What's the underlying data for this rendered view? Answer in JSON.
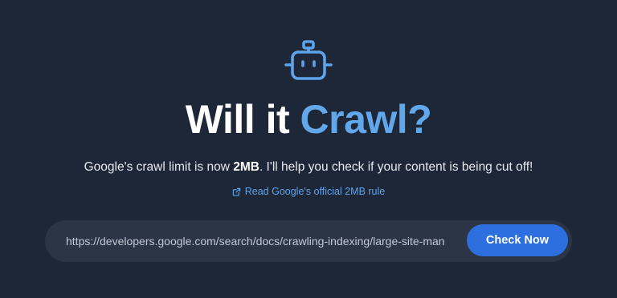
{
  "hero": {
    "icon": "robot-icon",
    "title_main": "Will it ",
    "title_accent": "Crawl?",
    "subtitle_pre": "Google's crawl limit is now ",
    "subtitle_bold": "2MB",
    "subtitle_post": ". I'll help you check if your content is being cut off!",
    "rule_link_label": "Read Google's official 2MB rule",
    "rule_link_icon": "external-link-icon"
  },
  "search": {
    "url_value": "https://developers.google.com/search/docs/crawling-indexing/large-site-managing-crawl-budget",
    "button_label": "Check Now"
  },
  "colors": {
    "background": "#1e2737",
    "accent": "#62a7ea",
    "button": "#2e6fe0",
    "input_bg": "#2b3546"
  }
}
